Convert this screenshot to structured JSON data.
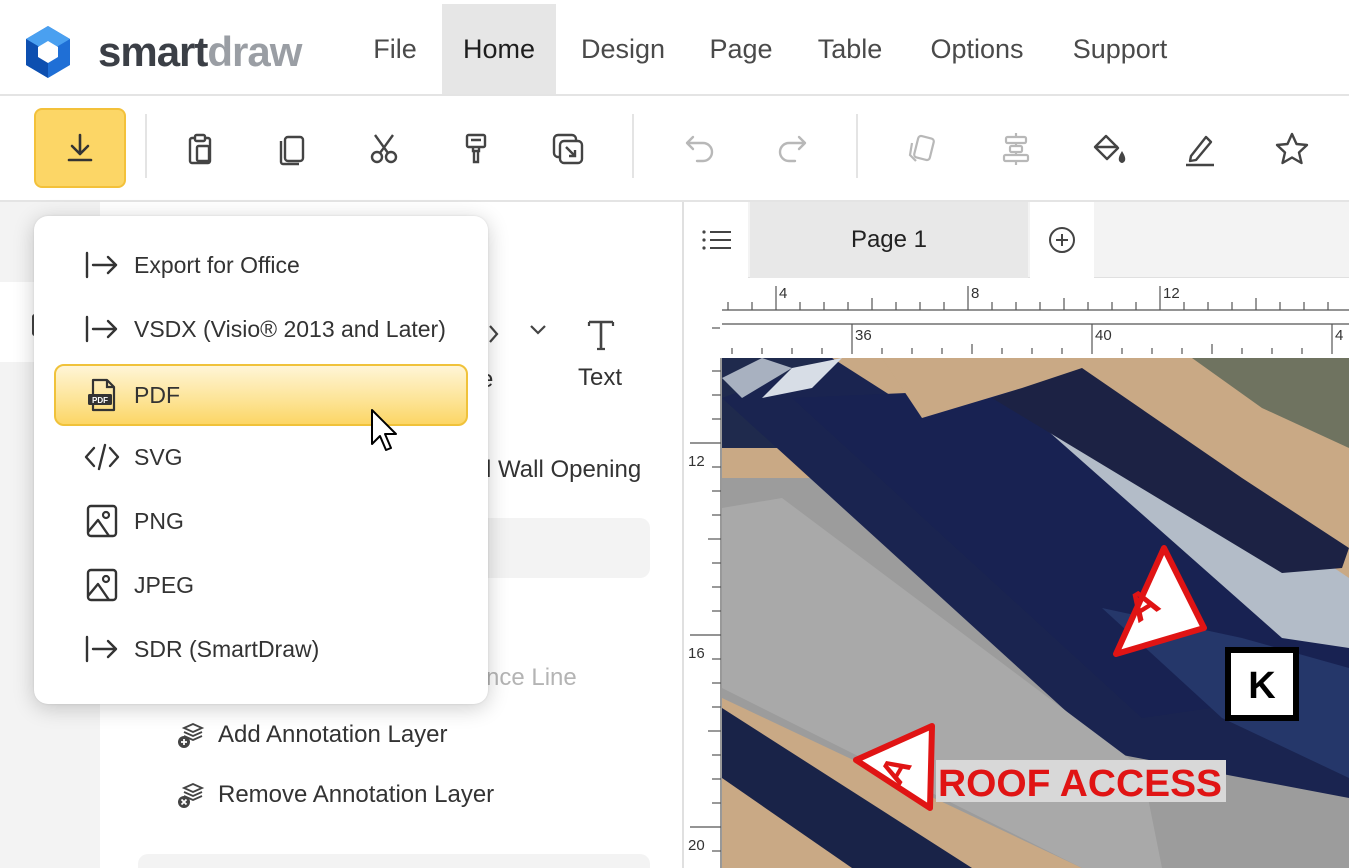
{
  "app": {
    "logo_smart": "smart",
    "logo_draw": "draw"
  },
  "menu": {
    "items": [
      "File",
      "Home",
      "Design",
      "Page",
      "Table",
      "Options",
      "Support"
    ],
    "active": "Home"
  },
  "toolbar": {
    "icons": [
      "download-icon",
      "paste-icon",
      "copy-icon",
      "cut-icon",
      "format-painter-icon",
      "arrange-icon",
      "undo-icon",
      "redo-icon",
      "shapes-icon",
      "align-icon",
      "fill-icon",
      "line-icon",
      "star-icon"
    ]
  },
  "export_menu": {
    "items": [
      {
        "label": "Export for Office",
        "icon": "export-arrow-icon"
      },
      {
        "label": "VSDX (Visio® 2013 and Later)",
        "icon": "export-arrow-icon"
      },
      {
        "label": "PDF",
        "icon": "pdf-file-icon"
      },
      {
        "label": "SVG",
        "icon": "code-icon"
      },
      {
        "label": "PNG",
        "icon": "image-icon"
      },
      {
        "label": "JPEG",
        "icon": "image-icon"
      },
      {
        "label": "SDR (SmartDraw)",
        "icon": "export-arrow-icon"
      }
    ],
    "selected": "PDF"
  },
  "left_panel": {
    "text_tool_label": "Text",
    "partial_e": "e",
    "wall_opening_partial": "l Wall Opening",
    "nce_line_partial": "nce Line",
    "add_layer": "Add Annotation Layer",
    "remove_layer": "Remove Annotation Layer"
  },
  "canvas": {
    "page_tab": "Page 1",
    "ruler_top_major": [
      "4",
      "8",
      "12"
    ],
    "ruler_top_minor": [
      "36",
      "40",
      "4"
    ],
    "ruler_left": [
      "12",
      "16",
      "20"
    ],
    "annotation_a1": "A",
    "annotation_a2": "A",
    "annotation_k": "K",
    "roof_access": "ROOF ACCESS"
  },
  "colors": {
    "accent_yellow": "#fcd666",
    "annotation_red": "#e01414"
  }
}
